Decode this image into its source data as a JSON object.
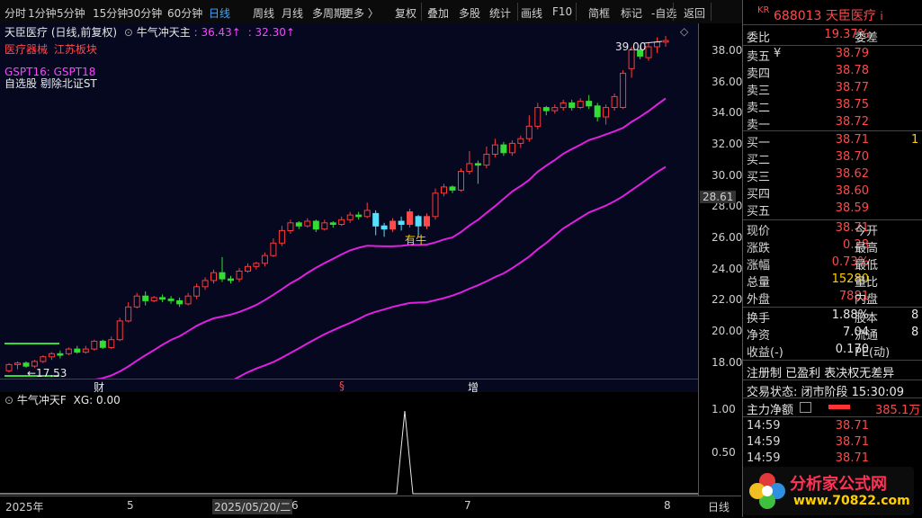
{
  "toolbar": {
    "items": [
      "分时",
      "1分钟",
      "5分钟",
      "15分钟",
      "30分钟",
      "60分钟",
      "日线",
      "周线",
      "月线",
      "多周期",
      "更多 〉",
      "复权",
      "叠加",
      "多股",
      "统计",
      "画线",
      "F10",
      "简框",
      "标记",
      "-自选",
      "返回"
    ],
    "active": "日线"
  },
  "header": {
    "stock_name": "天臣医疗",
    "mode": "(日线,前复权)",
    "indicator_name": "牛气冲天主",
    "ind_val1": ": 36.43↑",
    "ind_val2": ": 32.30↑",
    "sector1": "医疗器械",
    "sector2": "江苏板块",
    "gspt": "GSPT16: GSPT18",
    "tags": "自选股 剔除北证ST",
    "hi_label": "39.00",
    "lo_label": "←17.53",
    "signal_label": "有牛",
    "marker_cai": "财",
    "marker_s": "§",
    "marker_zeng": "增",
    "current_price_tag": "28.61"
  },
  "price_axis": [
    "38.00",
    "36.00",
    "34.00",
    "32.00",
    "30.00",
    "28.00",
    "26.00",
    "24.00",
    "22.00",
    "20.00",
    "18.00"
  ],
  "sub": {
    "title": "牛气冲天F",
    "xg": "XG: 0.00",
    "axis": [
      "1.00",
      "0.50"
    ]
  },
  "time_axis": {
    "labels": [
      "2025年",
      "5",
      "2025/05/20/二",
      "6",
      "7",
      "8"
    ],
    "right": "日线"
  },
  "panel": {
    "code_prefix": "KR",
    "code": "688013",
    "name": "天臣医疗",
    "info_icon": "i",
    "weibi_label": "委比",
    "weibi_val": "19.37%",
    "weicha_label": "委差",
    "asks": [
      {
        "label": "卖五",
        "flag": "¥",
        "price": "38.79"
      },
      {
        "label": "卖四",
        "flag": "",
        "price": "38.78"
      },
      {
        "label": "卖三",
        "flag": "",
        "price": "38.77"
      },
      {
        "label": "卖二",
        "flag": "",
        "price": "38.75"
      },
      {
        "label": "卖一",
        "flag": "",
        "price": "38.72"
      }
    ],
    "bids": [
      {
        "label": "买一",
        "price": "38.71",
        "extra": "1"
      },
      {
        "label": "买二",
        "price": "38.70",
        "extra": ""
      },
      {
        "label": "买三",
        "price": "38.62",
        "extra": ""
      },
      {
        "label": "买四",
        "price": "38.60",
        "extra": ""
      },
      {
        "label": "买五",
        "price": "38.59",
        "extra": ""
      }
    ],
    "stats": [
      {
        "k": "现价",
        "v": "38.71",
        "k2": "今开",
        "c": "red"
      },
      {
        "k": "涨跌",
        "v": "0.28",
        "k2": "最高",
        "c": "red"
      },
      {
        "k": "涨幅",
        "v": "0.73%",
        "k2": "最低",
        "c": "red"
      },
      {
        "k": "总量",
        "v": "15280",
        "k2": "量比",
        "c": "yellow"
      },
      {
        "k": "外盘",
        "v": "7881",
        "k2": "内盘",
        "c": "red"
      }
    ],
    "stats2": [
      {
        "k": "换手",
        "v": "1.88%",
        "k2": "股本",
        "e": "8"
      },
      {
        "k": "净资",
        "v": "7.04",
        "k2": "流通",
        "e": "8"
      },
      {
        "k": "收益(-)",
        "v": "0.170",
        "k2": "PE(动)",
        "e": ""
      }
    ],
    "badges": "注册制 已盈利 表决权无差异",
    "trade_state": "交易状态: 闭市阶段 15:30:09",
    "mainforce_label": "主力净额",
    "mainforce_val": "385.1万",
    "ticks": [
      {
        "t": "14:59",
        "p": "38.71"
      },
      {
        "t": "14:59",
        "p": "38.71"
      },
      {
        "t": "14:59",
        "p": "38.71"
      }
    ]
  },
  "watermark": {
    "text": "分析家公式网",
    "url": "www.70822.com"
  },
  "chart_data": {
    "type": "candlestick",
    "ylim": [
      17,
      39.8
    ],
    "hi": 39.0,
    "lo": 17.53,
    "candles": [
      [
        17.5,
        17.9,
        17.4,
        18.0
      ],
      [
        17.9,
        18.0,
        17.6,
        18.1
      ],
      [
        18.0,
        17.8,
        17.7,
        18.1
      ],
      [
        17.8,
        18.1,
        17.7,
        18.2
      ],
      [
        18.1,
        18.4,
        18.0,
        18.5
      ],
      [
        18.4,
        18.6,
        18.2,
        18.7
      ],
      [
        18.6,
        18.5,
        18.3,
        18.8
      ],
      [
        18.6,
        18.9,
        18.5,
        19.0
      ],
      [
        18.9,
        18.7,
        18.6,
        19.1
      ],
      [
        18.7,
        18.9,
        18.6,
        19.1
      ],
      [
        18.9,
        19.4,
        18.8,
        19.5
      ],
      [
        19.4,
        19.0,
        18.9,
        19.5
      ],
      [
        19.0,
        19.5,
        18.9,
        19.7
      ],
      [
        19.5,
        20.7,
        19.4,
        20.9
      ],
      [
        20.7,
        21.6,
        20.6,
        21.9
      ],
      [
        21.6,
        22.3,
        21.5,
        22.5
      ],
      [
        22.3,
        22.0,
        21.7,
        22.6
      ],
      [
        22.0,
        22.2,
        21.9,
        22.3
      ],
      [
        22.2,
        22.1,
        21.9,
        22.4
      ],
      [
        22.1,
        22.0,
        21.8,
        22.3
      ],
      [
        22.0,
        21.8,
        21.6,
        22.2
      ],
      [
        21.8,
        22.3,
        21.7,
        22.5
      ],
      [
        22.3,
        22.9,
        22.1,
        23.1
      ],
      [
        22.9,
        23.3,
        22.7,
        23.5
      ],
      [
        23.3,
        23.8,
        23.1,
        24.0
      ],
      [
        23.8,
        23.4,
        23.2,
        24.8
      ],
      [
        23.4,
        23.3,
        23.1,
        23.6
      ],
      [
        23.4,
        23.9,
        23.2,
        24.1
      ],
      [
        23.9,
        24.2,
        23.8,
        24.4
      ],
      [
        24.2,
        24.4,
        24.0,
        24.5
      ],
      [
        24.4,
        24.9,
        24.2,
        25.1
      ],
      [
        24.9,
        25.7,
        24.8,
        26.0
      ],
      [
        25.7,
        26.5,
        25.5,
        26.8
      ],
      [
        26.5,
        27.0,
        26.3,
        27.2
      ],
      [
        27.0,
        26.8,
        26.6,
        27.1
      ],
      [
        26.8,
        27.1,
        26.7,
        27.3
      ],
      [
        27.1,
        26.6,
        26.4,
        27.2
      ],
      [
        26.6,
        27.0,
        26.5,
        27.2
      ],
      [
        27.0,
        26.9,
        26.7,
        27.1
      ],
      [
        26.9,
        27.2,
        26.8,
        27.4
      ],
      [
        27.2,
        27.5,
        27.0,
        27.7
      ],
      [
        27.5,
        27.4,
        27.2,
        27.7
      ],
      [
        27.4,
        27.8,
        27.3,
        28.3
      ],
      [
        27.6,
        26.8,
        26.2,
        27.8
      ],
      [
        26.8,
        26.6,
        26.1,
        27.0
      ],
      [
        26.6,
        27.1,
        26.4,
        27.3
      ],
      [
        27.1,
        26.9,
        26.5,
        27.4
      ],
      [
        26.9,
        27.7,
        26.7,
        27.9
      ],
      [
        27.4,
        26.8,
        26.2,
        27.5
      ],
      [
        26.8,
        27.4,
        26.6,
        27.6
      ],
      [
        27.4,
        28.9,
        27.2,
        29.2
      ],
      [
        28.9,
        29.3,
        28.7,
        29.5
      ],
      [
        29.3,
        29.1,
        28.9,
        29.4
      ],
      [
        29.1,
        30.3,
        29.0,
        30.5
      ],
      [
        30.3,
        30.8,
        30.1,
        31.6
      ],
      [
        30.8,
        30.7,
        29.5,
        31.0
      ],
      [
        30.7,
        31.4,
        30.5,
        31.9
      ],
      [
        31.4,
        32.0,
        31.2,
        32.4
      ],
      [
        32.0,
        31.5,
        31.3,
        32.2
      ],
      [
        31.5,
        32.1,
        31.3,
        32.3
      ],
      [
        32.1,
        32.4,
        31.8,
        32.6
      ],
      [
        32.4,
        33.2,
        32.2,
        33.9
      ],
      [
        33.2,
        34.4,
        33.0,
        34.7
      ],
      [
        34.4,
        34.2,
        33.9,
        34.5
      ],
      [
        34.2,
        34.4,
        34.0,
        34.6
      ],
      [
        34.4,
        34.7,
        34.2,
        34.9
      ],
      [
        34.7,
        34.4,
        34.2,
        34.9
      ],
      [
        34.4,
        34.8,
        34.3,
        35.0
      ],
      [
        34.8,
        34.5,
        34.3,
        35.2
      ],
      [
        34.5,
        33.8,
        33.5,
        34.7
      ],
      [
        33.8,
        34.4,
        33.3,
        34.6
      ],
      [
        34.4,
        35.1,
        34.2,
        35.3
      ],
      [
        34.4,
        36.6,
        34.3,
        36.8
      ],
      [
        36.9,
        38.1,
        36.3,
        38.3
      ],
      [
        38.1,
        37.7,
        37.5,
        38.4
      ],
      [
        37.6,
        38.3,
        37.4,
        38.6
      ],
      [
        38.3,
        38.6,
        37.9,
        38.9
      ],
      [
        38.6,
        38.7,
        38.3,
        39.0
      ]
    ]
  }
}
